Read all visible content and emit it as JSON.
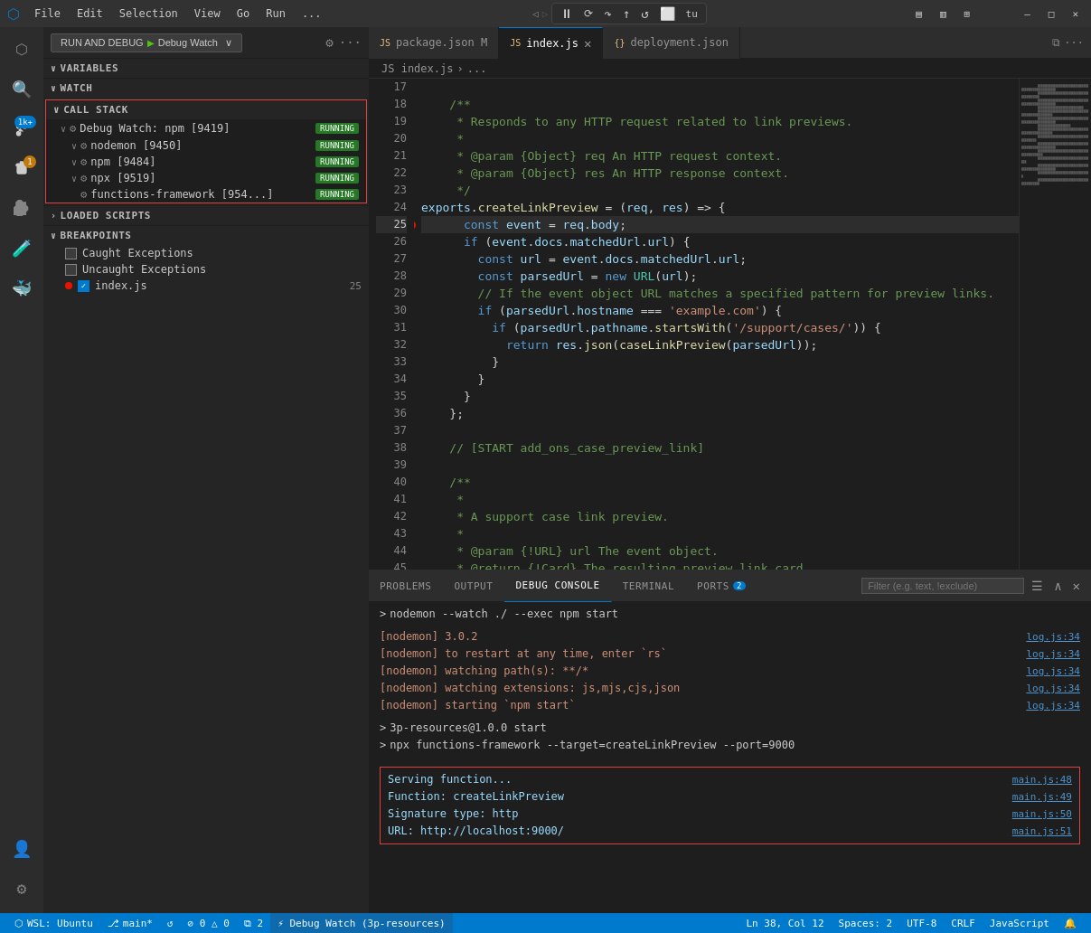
{
  "titleBar": {
    "menus": [
      "File",
      "Edit",
      "Selection",
      "View",
      "Go",
      "Run",
      "..."
    ]
  },
  "debugToolbar": {
    "buttons": [
      "⏸",
      "⏭",
      "↩",
      "↪",
      "⬆",
      "↕",
      "↺",
      "⬜",
      "tu"
    ]
  },
  "sidebar": {
    "runDebugLabel": "RUN AND DEBUG",
    "debugConfig": "Debug Watch",
    "variablesLabel": "VARIABLES",
    "watchLabel": "WATCH",
    "callStackLabel": "CALL STACK",
    "callStackItems": [
      {
        "name": "Debug Watch: npm [9419]",
        "status": "RUNNING",
        "indent": 1
      },
      {
        "name": "nodemon [9450]",
        "status": "RUNNING",
        "indent": 2
      },
      {
        "name": "npm [9484]",
        "status": "RUNNING",
        "indent": 2
      },
      {
        "name": "npx [9519]",
        "status": "RUNNING",
        "indent": 2
      },
      {
        "name": "functions-framework [954...]",
        "status": "RUNNING",
        "indent": 3
      }
    ],
    "loadedScriptsLabel": "LOADED SCRIPTS",
    "breakpointsLabel": "BREAKPOINTS",
    "breakpointItems": [
      {
        "label": "Caught Exceptions",
        "checked": false,
        "dot": false
      },
      {
        "label": "Uncaught Exceptions",
        "checked": false,
        "dot": false
      },
      {
        "label": "index.js",
        "checked": true,
        "dot": true,
        "line": 25
      }
    ]
  },
  "tabs": [
    {
      "label": "package.json",
      "icon": "JS",
      "modified": true,
      "active": false
    },
    {
      "label": "index.js",
      "icon": "JS",
      "active": true
    },
    {
      "label": "deployment.json",
      "icon": "{}",
      "active": false
    }
  ],
  "breadcrumb": {
    "path": "JS index.js > ..."
  },
  "codeEditor": {
    "startLine": 17,
    "lines": [
      {
        "num": 17,
        "content": ""
      },
      {
        "num": 18,
        "content": "    /**",
        "type": "comment"
      },
      {
        "num": 19,
        "content": "     * Responds to any HTTP request related to link previews.",
        "type": "comment"
      },
      {
        "num": 20,
        "content": "     *",
        "type": "comment"
      },
      {
        "num": 21,
        "content": "     * @param {Object} req An HTTP request context.",
        "type": "comment"
      },
      {
        "num": 22,
        "content": "     * @param {Object} res An HTTP response context.",
        "type": "comment"
      },
      {
        "num": 23,
        "content": "     */",
        "type": "comment"
      },
      {
        "num": 24,
        "content": "    exports.createLinkPreview = (req, res) => {",
        "type": "code"
      },
      {
        "num": 25,
        "content": "      const event = req.body;",
        "type": "code",
        "breakpoint": true
      },
      {
        "num": 26,
        "content": "      if (event.docs.matchedUrl.url) {",
        "type": "code"
      },
      {
        "num": 27,
        "content": "        const url = event.docs.matchedUrl.url;",
        "type": "code"
      },
      {
        "num": 28,
        "content": "        const parsedUrl = new URL(url);",
        "type": "code"
      },
      {
        "num": 29,
        "content": "        // If the event object URL matches a specified pattern for preview links.",
        "type": "comment"
      },
      {
        "num": 30,
        "content": "        if (parsedUrl.hostname === 'example.com') {",
        "type": "code"
      },
      {
        "num": 31,
        "content": "          if (parsedUrl.pathname.startsWith('/support/cases/')) {",
        "type": "code"
      },
      {
        "num": 32,
        "content": "            return res.json(caseLinkPreview(parsedUrl));",
        "type": "code"
      },
      {
        "num": 33,
        "content": "          }",
        "type": "code"
      },
      {
        "num": 34,
        "content": "        }",
        "type": "code"
      },
      {
        "num": 35,
        "content": "      }",
        "type": "code"
      },
      {
        "num": 36,
        "content": "    };",
        "type": "code"
      },
      {
        "num": 37,
        "content": ""
      },
      {
        "num": 38,
        "content": "    // [START add_ons_case_preview_link]",
        "type": "comment"
      },
      {
        "num": 39,
        "content": ""
      },
      {
        "num": 40,
        "content": "    /**",
        "type": "comment"
      },
      {
        "num": 41,
        "content": "     *",
        "type": "comment"
      },
      {
        "num": 42,
        "content": "     * A support case link preview.",
        "type": "comment"
      },
      {
        "num": 43,
        "content": "     *",
        "type": "comment"
      },
      {
        "num": 44,
        "content": "     * @param {!URL} url The event object.",
        "type": "comment"
      },
      {
        "num": 45,
        "content": "     * @return {!Card} The resulting preview link card.",
        "type": "comment"
      }
    ]
  },
  "panelTabs": [
    "PROBLEMS",
    "OUTPUT",
    "DEBUG CONSOLE",
    "TERMINAL",
    "PORTS"
  ],
  "portsCount": 2,
  "activePanel": "DEBUG CONSOLE",
  "consoleFilter": "Filter (e.g. text, !exclude)",
  "consoleLines": [
    {
      "type": "prompt",
      "content": "nodemon --watch ./ --exec npm start"
    },
    {
      "type": "blank"
    },
    {
      "type": "text",
      "content": "[nodemon] 3.0.2",
      "linkText": "log.js:34"
    },
    {
      "type": "text",
      "content": "[nodemon] to restart at any time, enter `rs`",
      "linkText": "log.js:34"
    },
    {
      "type": "text",
      "content": "[nodemon] watching path(s): **/*",
      "linkText": "log.js:34"
    },
    {
      "type": "text",
      "content": "[nodemon] watching extensions: js,mjs,cjs,json",
      "linkText": "log.js:34"
    },
    {
      "type": "text",
      "content": "[nodemon] starting `npm start`",
      "linkText": "log.js:34"
    },
    {
      "type": "blank"
    },
    {
      "type": "prompt",
      "content": "> 3p-resources@1.0.0 start"
    },
    {
      "type": "prompt",
      "content": "> npx functions-framework --target=createLinkPreview --port=9000"
    },
    {
      "type": "blank"
    },
    {
      "type": "highlight_start"
    },
    {
      "type": "highlight",
      "content": "Serving function...",
      "linkText": "main.js:48"
    },
    {
      "type": "highlight",
      "content": "Function: createLinkPreview",
      "linkText": "main.js:49"
    },
    {
      "type": "highlight",
      "content": "Signature type: http",
      "linkText": "main.js:50"
    },
    {
      "type": "highlight",
      "content": "URL: http://localhost:9000/",
      "linkText": "main.js:51"
    },
    {
      "type": "highlight_end"
    }
  ],
  "statusBar": {
    "git": "⎇ main*",
    "sync": "↺",
    "errors": "⊘ 0 △ 0",
    "ports": "⧉ 2",
    "debugInfo": "⚡ Debug Watch (3p-resources)",
    "position": "Ln 38, Col 12",
    "spaces": "Spaces: 2",
    "encoding": "UTF-8",
    "lineEnding": "CRLF",
    "language": "JavaScript",
    "wsl": "WSL: Ubuntu"
  }
}
